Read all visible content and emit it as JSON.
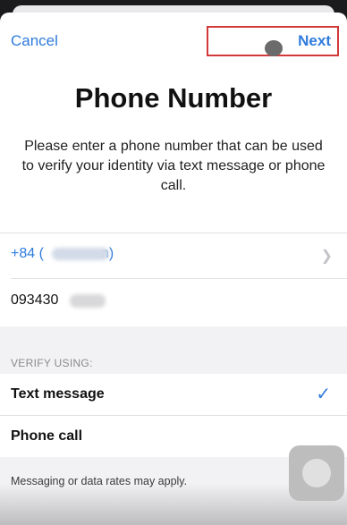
{
  "nav": {
    "cancel_label": "Cancel",
    "next_label": "Next"
  },
  "page": {
    "title": "Phone Number",
    "description": "Please enter a phone number that can be used to verify your identity via text message or phone call."
  },
  "form": {
    "country_code_prefix": "+84 (",
    "country_code_suffix": "n)",
    "phone_value_visible": "093430"
  },
  "verify": {
    "header": "VERIFY USING:",
    "options": [
      {
        "label": "Text message",
        "selected": true
      },
      {
        "label": "Phone call",
        "selected": false
      }
    ],
    "note": "Messaging or data rates may apply."
  },
  "icons": {
    "chevron": "chevron-right-icon",
    "check": "checkmark-icon",
    "assistive_touch": "assistive-touch-icon"
  },
  "colors": {
    "accent": "#2f7bdd",
    "highlight": "#d23a3a",
    "background_gray": "#f2f2f4"
  }
}
